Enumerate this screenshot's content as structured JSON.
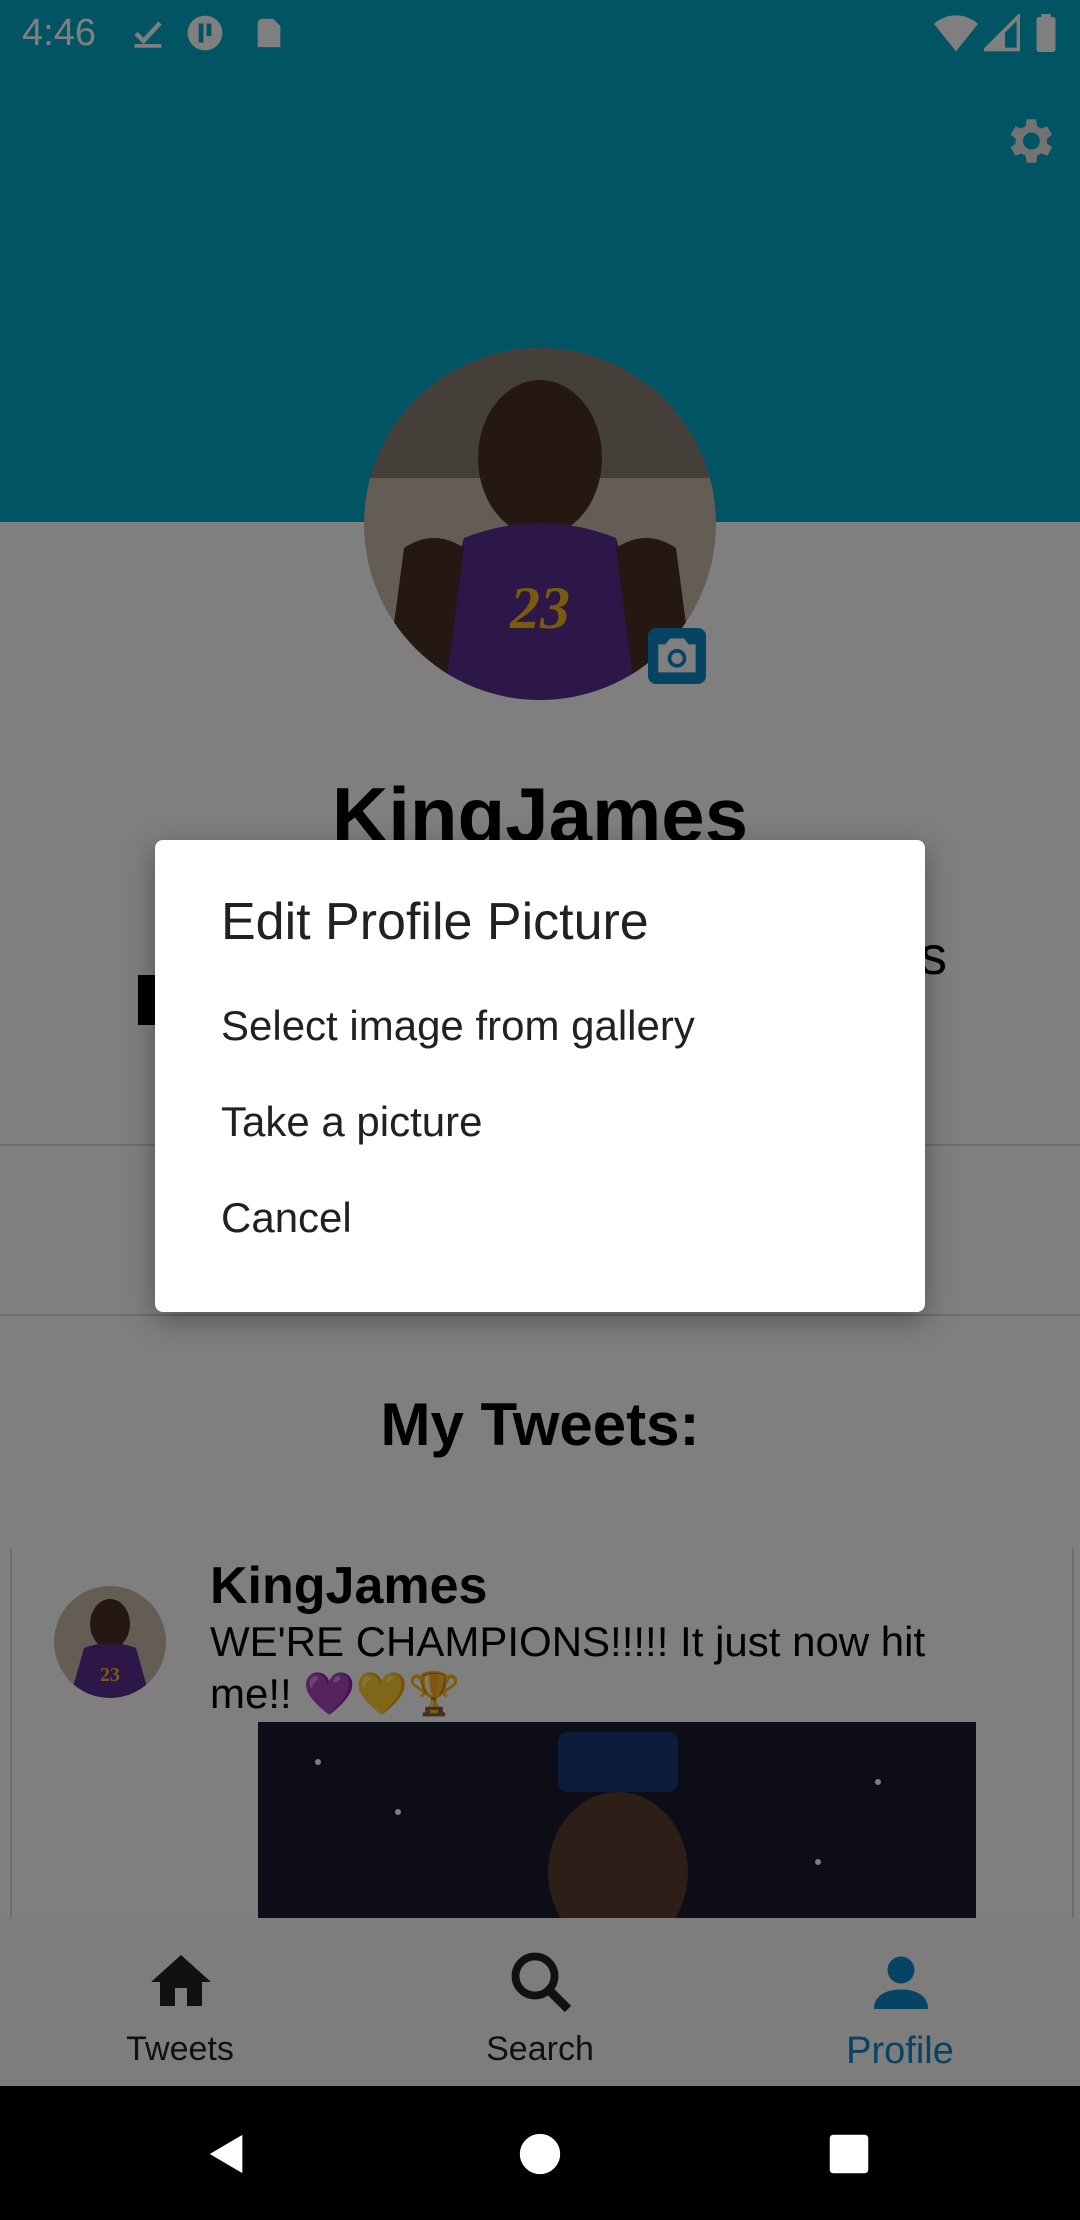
{
  "status_bar": {
    "time": "4:46"
  },
  "profile": {
    "username": "KingJames",
    "stat_peek": "s"
  },
  "tweets_section": {
    "title": "My Tweets:",
    "tweets": [
      {
        "user": "KingJames",
        "text": "WE'RE CHAMPIONS!!!!! It just now hit me!! 💜💛🏆"
      }
    ]
  },
  "bottom_nav": {
    "items": [
      {
        "label": "Tweets",
        "icon": "home-icon"
      },
      {
        "label": "Search",
        "icon": "search-icon"
      },
      {
        "label": "Profile",
        "icon": "person-icon"
      }
    ],
    "active": "Profile"
  },
  "dialog": {
    "title": "Edit Profile Picture",
    "options": [
      "Select image from gallery",
      "Take a picture",
      "Cancel"
    ]
  },
  "colors": {
    "accent": "#03a9c7",
    "nav_active": "#0e88c8"
  }
}
